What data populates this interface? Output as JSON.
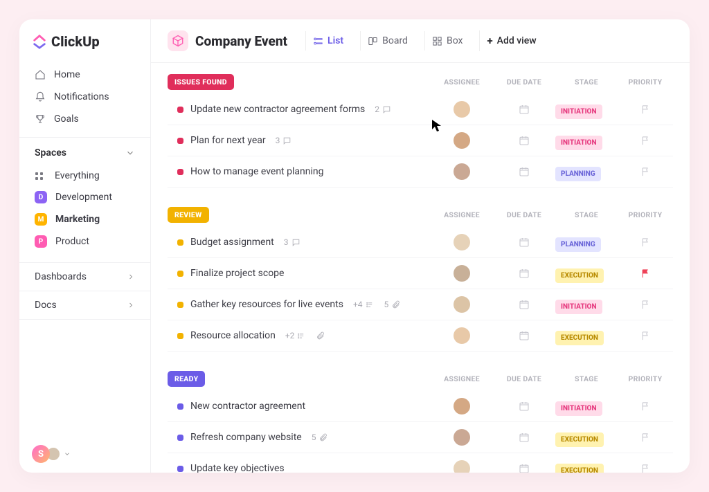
{
  "brand": "ClickUp",
  "nav": {
    "home": "Home",
    "notifications": "Notifications",
    "goals": "Goals"
  },
  "spacesHeader": "Spaces",
  "spaces": {
    "everything": "Everything",
    "dev": {
      "letter": "D",
      "label": "Development",
      "color": "#8c63f4"
    },
    "mkt": {
      "letter": "M",
      "label": "Marketing",
      "color": "#ffb400"
    },
    "prd": {
      "letter": "P",
      "label": "Product",
      "color": "#ff5cb2"
    }
  },
  "dashboards": "Dashboards",
  "docs": "Docs",
  "userInitial": "S",
  "page": {
    "title": "Company Event",
    "tabs": {
      "list": "List",
      "board": "Board",
      "box": "Box",
      "add": "Add view"
    }
  },
  "columns": {
    "assignee": "ASSIGNEE",
    "due": "DUE DATE",
    "stage": "STAGE",
    "priority": "PRIORITY"
  },
  "stages": {
    "initiation": {
      "label": "INITIATION",
      "bg": "#ffdbe9",
      "fg": "#e6397e"
    },
    "planning": {
      "label": "PLANNING",
      "bg": "#e3e4ff",
      "fg": "#6a65d8"
    },
    "execution": {
      "label": "EXECUTION",
      "bg": "#fff2b0",
      "fg": "#b88a00"
    }
  },
  "groups": [
    {
      "name": "ISSUES FOUND",
      "color": "#e02e5b",
      "tasks": [
        {
          "title": "Update new contractor agreement forms",
          "comments": 2,
          "stage": "initiation"
        },
        {
          "title": "Plan for next year",
          "comments": 3,
          "stage": "initiation"
        },
        {
          "title": "How to manage event planning",
          "stage": "planning"
        }
      ]
    },
    {
      "name": "REVIEW",
      "color": "#f2b200",
      "tasks": [
        {
          "title": "Budget assignment",
          "comments": 3,
          "redflag": true,
          "stage": "planning"
        },
        {
          "title": "Finalize project scope",
          "stage": "execution",
          "priority_red": true
        },
        {
          "title": "Gather key resources for live events",
          "subtasks": 4,
          "attachments": 5,
          "stage": "initiation"
        },
        {
          "title": "Resource allocation",
          "subtasks": 2,
          "attachIcon": true,
          "stage": "execution"
        }
      ]
    },
    {
      "name": "READY",
      "color": "#6b5ce7",
      "tasks": [
        {
          "title": "New contractor agreement",
          "stage": "initiation"
        },
        {
          "title": "Refresh company website",
          "attachments": 5,
          "stage": "execution"
        },
        {
          "title": "Update key objectives",
          "stage": "execution"
        }
      ]
    }
  ]
}
